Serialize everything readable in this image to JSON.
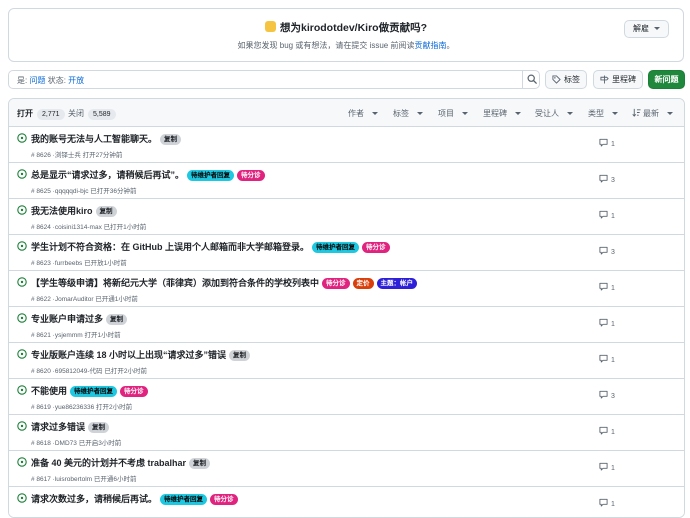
{
  "banner": {
    "title": "想为kirodotdev/Kiro做贡献吗?",
    "subtitle_prefix": "如果您发现 bug 或有想法，请在提交 issue 前阅读",
    "subtitle_link": "贡献指南",
    "subtitle_suffix": "。",
    "dismiss": "解雇"
  },
  "search": {
    "prefix": "是:",
    "is_value": "问题",
    "state_label": "状态:",
    "state_value": "开放"
  },
  "toolbar": {
    "labels": "标签",
    "milestones": "里程碑",
    "new_issue": "新问题"
  },
  "list_header": {
    "open_label": "打开",
    "open_count": "2,771",
    "closed_label": "关闭",
    "closed_count": "5,589",
    "filters": [
      "作者",
      "标签",
      "项目",
      "里程碑",
      "受让人",
      "类型"
    ],
    "sort": "最新"
  },
  "colors": {
    "open_green": "#1a7f37",
    "label_waiting": "#1ec8e0",
    "label_triage": "#e0237f",
    "label_pricing": "#d93f0b",
    "label_account": "#2d20d8",
    "label_duplicate": "#cfd3d7"
  },
  "issues": [
    {
      "title": "我的账号无法与人工智能聊天。",
      "meta": "# 8626 ·浏铎士兵 打开27分钟前",
      "comments": "1",
      "labels": [
        {
          "text": "复制",
          "kind": "duplicate"
        }
      ]
    },
    {
      "title": "总是显示“请求过多，请稍候后再试”。",
      "meta": "# 8625 ·qqqqqdi-bjc 已打开36分钟前",
      "comments": "3",
      "labels": [
        {
          "text": "待维护者回复",
          "kind": "waiting"
        },
        {
          "text": "待分诊",
          "kind": "triage"
        }
      ]
    },
    {
      "title": "我无法使用kiro",
      "meta": "# 8624 ·coisini1314-max 已打开1小时前",
      "comments": "1",
      "labels": [
        {
          "text": "复制",
          "kind": "duplicate"
        }
      ]
    },
    {
      "title": "学生计划不符合资格：在 GitHub 上误用个人邮箱而非大学邮箱登录。",
      "meta": "# 8623 ·furrbeebs 已开放1小时前",
      "comments": "3",
      "labels": [
        {
          "text": "待维护者回复",
          "kind": "waiting"
        },
        {
          "text": "待分诊",
          "kind": "triage"
        }
      ]
    },
    {
      "title": "【学生等级申请】将新纪元大学（菲律宾）添加到符合条件的学校列表中",
      "meta": "# 8622 ·JomarAuditor 已开通1小时前",
      "comments": "1",
      "labels": [
        {
          "text": "待分诊",
          "kind": "triage"
        },
        {
          "text": "定价",
          "kind": "pricing"
        },
        {
          "text": "主题：帐户",
          "kind": "account"
        }
      ]
    },
    {
      "title": "专业账户申请过多",
      "meta": "# 8621 ·ysjemmm 打开1小时前",
      "comments": "1",
      "labels": [
        {
          "text": "复制",
          "kind": "duplicate"
        }
      ]
    },
    {
      "title": "专业版账户连续 18 小时以上出现“请求过多”错误",
      "meta": "# 8620 ·695812049-代码 已打开2小时前",
      "comments": "1",
      "labels": [
        {
          "text": "复制",
          "kind": "duplicate"
        }
      ]
    },
    {
      "title": "不能使用",
      "meta": "# 8619 ·yue86236336 打开2小时前",
      "comments": "3",
      "labels": [
        {
          "text": "待维护者回复",
          "kind": "waiting"
        },
        {
          "text": "待分诊",
          "kind": "triage"
        }
      ]
    },
    {
      "title": "请求过多错误",
      "meta": "# 8618 ·DMD73 已开启3小时前",
      "comments": "1",
      "labels": [
        {
          "text": "复制",
          "kind": "duplicate"
        }
      ]
    },
    {
      "title": "准备 40 美元的计划并不考虑 trabalhar",
      "meta": "# 8617 ·luisrobertolm 已开通6小时前",
      "comments": "1",
      "labels": [
        {
          "text": "复制",
          "kind": "duplicate"
        }
      ]
    },
    {
      "title": "请求次数过多，请稍候后再试。",
      "meta": "",
      "comments": "1",
      "labels": [
        {
          "text": "待维护者回复",
          "kind": "waiting"
        },
        {
          "text": "待分诊",
          "kind": "triage"
        }
      ]
    }
  ]
}
